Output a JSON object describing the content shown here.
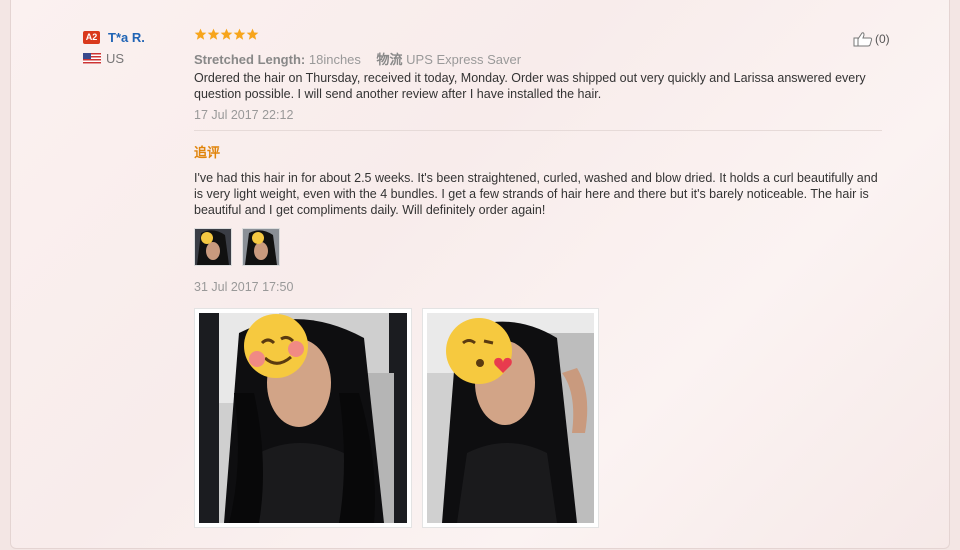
{
  "reviewer": {
    "level": "A2",
    "name": "T*a R.",
    "country": "US"
  },
  "review": {
    "rating": 5,
    "attributes": {
      "stretched_length_label": "Stretched Length:",
      "stretched_length_value": "18inches",
      "logistics_label": "物流",
      "logistics_value": "UPS Express Saver"
    },
    "text": "Ordered the hair on Thursday, received it today, Monday. Order was shipped out very quickly and Larissa answered every question possible. I will send another review after I have installed the hair.",
    "date": "17 Jul 2017 22:12"
  },
  "followup": {
    "label": "追评",
    "text": "I've had this hair in for about 2.5 weeks. It's been straightened, curled, washed and blow dried. It holds a curl beautifully and is very light weight, even with the 4 bundles. I get a few strands of hair here and there but it's barely noticeable. The hair is beautiful and I get compliments daily. Will definitely order again!",
    "date": "31 Jul 2017 17:50",
    "thumbnails": [
      "photo-1-thumb",
      "photo-2-thumb"
    ]
  },
  "helpful": {
    "count": "(0)"
  },
  "colors": {
    "star": "#f7a51c",
    "name_link": "#1f64b5",
    "followup_label": "#e0840b",
    "badge": "#d9391c"
  }
}
